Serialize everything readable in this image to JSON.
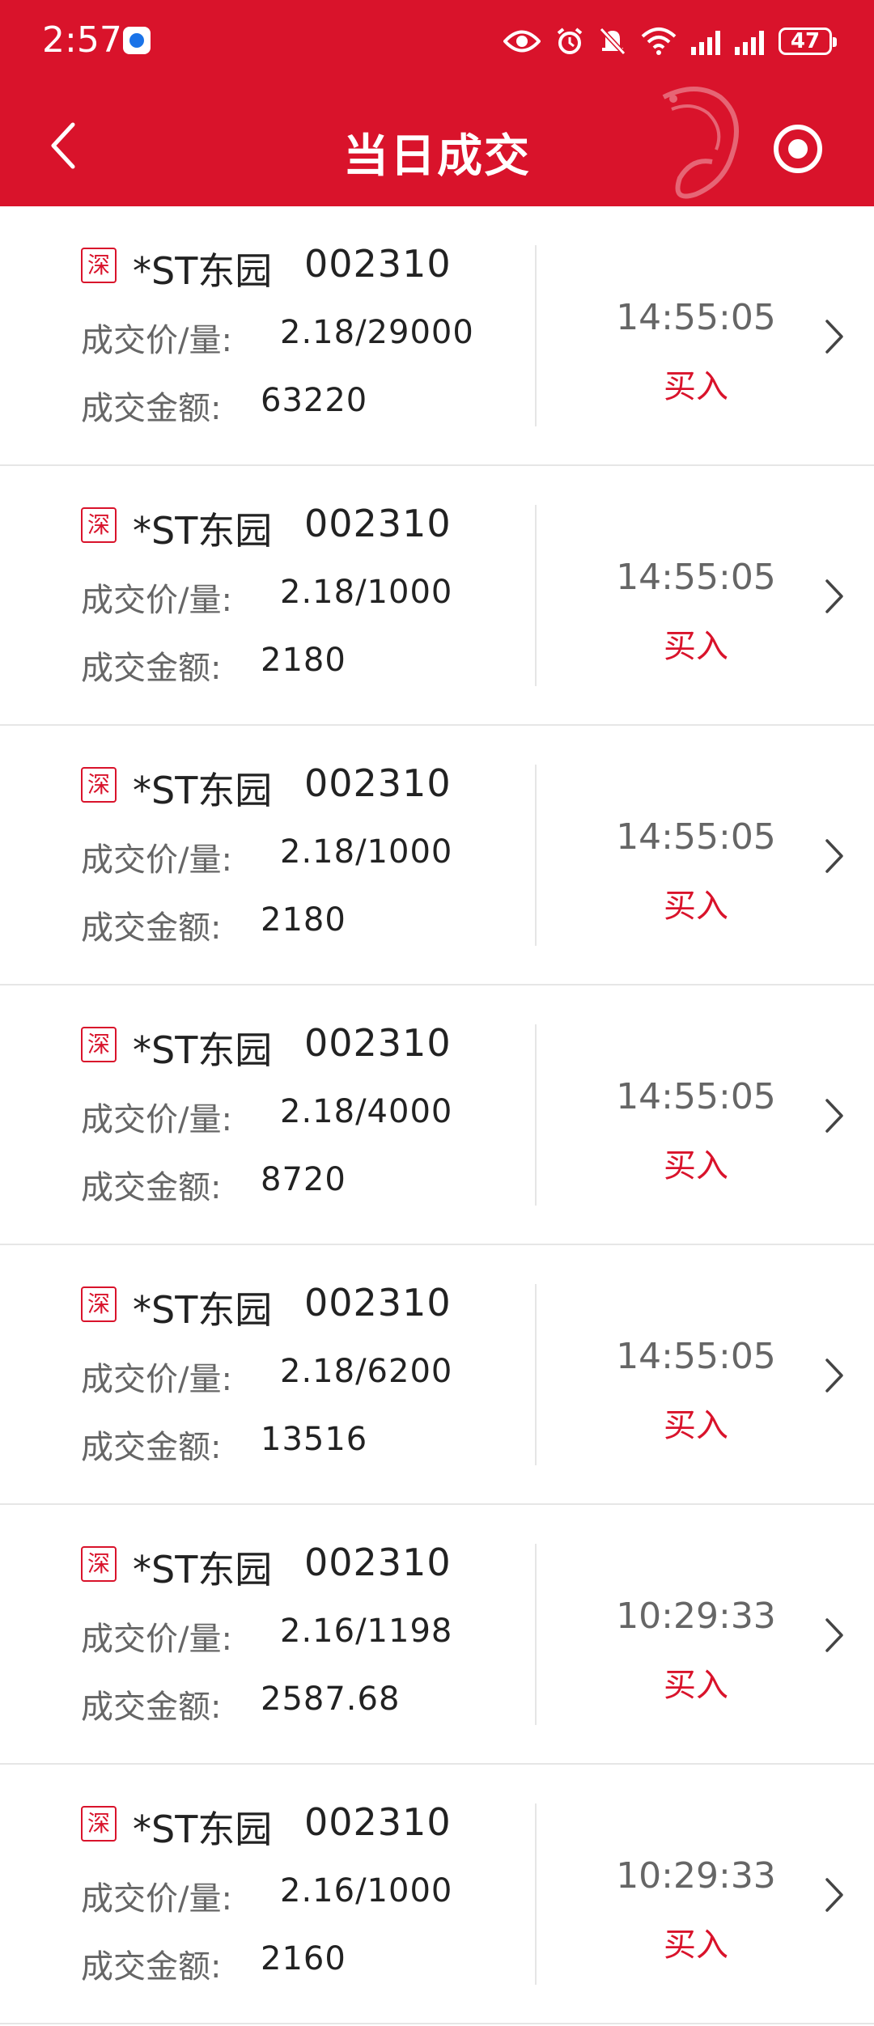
{
  "status_bar": {
    "time": "2:57",
    "battery": "47"
  },
  "header": {
    "title": "当日成交"
  },
  "trades": [
    {
      "market": "深",
      "name": "*ST东园",
      "code": "002310",
      "price_label": "成交价/量:",
      "price_qty": "2.18/29000",
      "amount_label": "成交金额:",
      "amount": "63220",
      "time": "14:55:05",
      "side": "买入"
    },
    {
      "market": "深",
      "name": "*ST东园",
      "code": "002310",
      "price_label": "成交价/量:",
      "price_qty": "2.18/1000",
      "amount_label": "成交金额:",
      "amount": "2180",
      "time": "14:55:05",
      "side": "买入"
    },
    {
      "market": "深",
      "name": "*ST东园",
      "code": "002310",
      "price_label": "成交价/量:",
      "price_qty": "2.18/1000",
      "amount_label": "成交金额:",
      "amount": "2180",
      "time": "14:55:05",
      "side": "买入"
    },
    {
      "market": "深",
      "name": "*ST东园",
      "code": "002310",
      "price_label": "成交价/量:",
      "price_qty": "2.18/4000",
      "amount_label": "成交金额:",
      "amount": "8720",
      "time": "14:55:05",
      "side": "买入"
    },
    {
      "market": "深",
      "name": "*ST东园",
      "code": "002310",
      "price_label": "成交价/量:",
      "price_qty": "2.18/6200",
      "amount_label": "成交金额:",
      "amount": "13516",
      "time": "14:55:05",
      "side": "买入"
    },
    {
      "market": "深",
      "name": "*ST东园",
      "code": "002310",
      "price_label": "成交价/量:",
      "price_qty": "2.16/1198",
      "amount_label": "成交金额:",
      "amount": "2587.68",
      "time": "10:29:33",
      "side": "买入"
    },
    {
      "market": "深",
      "name": "*ST东园",
      "code": "002310",
      "price_label": "成交价/量:",
      "price_qty": "2.16/1000",
      "amount_label": "成交金额:",
      "amount": "2160",
      "time": "10:29:33",
      "side": "买入"
    }
  ],
  "colors": {
    "brand": "#d9132b",
    "label": "#666666",
    "text": "#222222"
  },
  "icons": [
    "back-arrow-icon",
    "dragon-logo-icon",
    "target-icon",
    "chevron-right-icon",
    "eye-icon",
    "alarm-icon",
    "bell-off-icon",
    "wifi-icon",
    "signal-icon",
    "battery-icon"
  ]
}
